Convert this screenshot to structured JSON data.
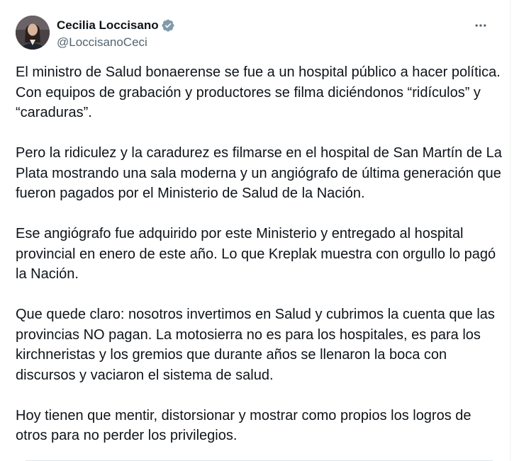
{
  "author": {
    "name": "Cecilia Loccisano",
    "handle": "@LoccisanoCeci",
    "verified_color": "#829aab"
  },
  "more_icon": "more-horizontal-icon",
  "paragraphs": [
    "El ministro de Salud bonaerense se fue a un hospital público a hacer política. Con equipos de grabación y productores se filma diciéndonos “ridículos” y “caraduras”.",
    "Pero la ridiculez y la caradurez es filmarse en el hospital de San Martín de La Plata mostrando una sala moderna y un angiógrafo de última generación que fueron pagados por el Ministerio de Salud de la Nación.",
    "Ese angiógrafo fue adquirido por este Ministerio y entregado al hospital provincial en enero de este año. Lo que Kreplak muestra con orgullo lo pagó la Nación.",
    "Que quede claro: nosotros invertimos en Salud y cubrimos la cuenta que las provincias NO pagan. La motosierra no es para los hospitales, es para los kirchneristas y los gremios que durante años se llenaron la boca con discursos y vaciaron el sistema de salud.",
    "Hoy tienen que mentir, distorsionar y mostrar como propios los logros de otros para no perder los privilegios."
  ]
}
